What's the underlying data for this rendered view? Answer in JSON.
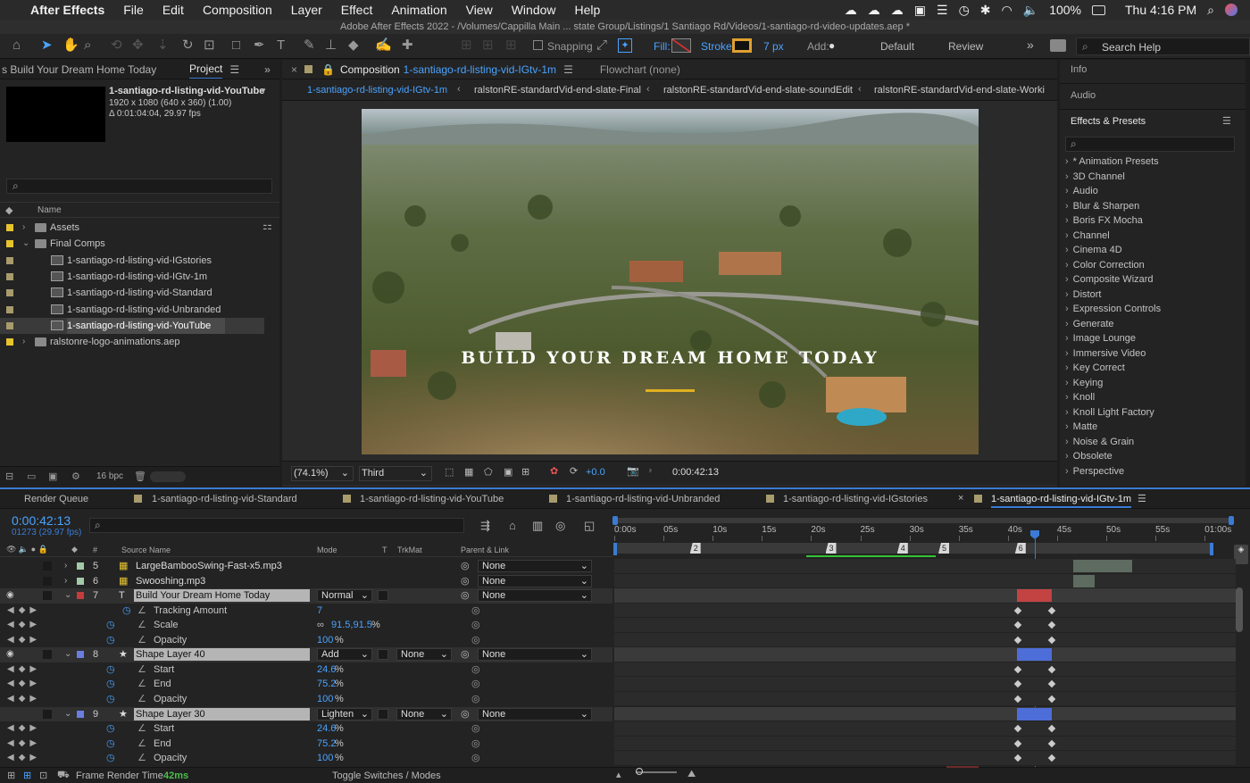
{
  "menubar": {
    "app": "After Effects",
    "items": [
      "File",
      "Edit",
      "Composition",
      "Layer",
      "Effect",
      "Animation",
      "View",
      "Window",
      "Help"
    ],
    "battery": "100%",
    "clock": "Thu 4:16 PM"
  },
  "window_title": "Adobe After Effects 2022 - /Volumes/Cappilla Main ... state Group/Listings/1 Santiago Rd/Videos/1-santiago-rd-video-updates.aep *",
  "toolbar": {
    "snapping": "Snapping",
    "fill": "Fill:",
    "stroke": "Stroke:",
    "stroke_px": "7 px",
    "add": "Add:",
    "workspace_default": "Default",
    "workspace_review": "Review",
    "search_help": "Search Help"
  },
  "project": {
    "tab_prev": "s Build Your Dream Home Today",
    "tab": "Project",
    "selected_name": "1-santiago-rd-listing-vid-YouTube",
    "selected_info1": "1920 x 1080 (640 x 360) (1.00)",
    "selected_info2": "Δ 0:01:04:04, 29.97 fps",
    "col_name": "Name",
    "bpc": "16 bpc",
    "items": [
      {
        "name": "Assets",
        "indent": 0,
        "type": "folder",
        "label": "#e6c42e",
        "open": false
      },
      {
        "name": "Final Comps",
        "indent": 0,
        "type": "folder",
        "label": "#e6c42e",
        "open": true
      },
      {
        "name": "1-santiago-rd-listing-vid-IGstories",
        "indent": 1,
        "type": "comp",
        "label": "#a89b6c"
      },
      {
        "name": "1-santiago-rd-listing-vid-IGtv-1m",
        "indent": 1,
        "type": "comp",
        "label": "#a89b6c"
      },
      {
        "name": "1-santiago-rd-listing-vid-Standard",
        "indent": 1,
        "type": "comp",
        "label": "#a89b6c"
      },
      {
        "name": "1-santiago-rd-listing-vid-Unbranded",
        "indent": 1,
        "type": "comp",
        "label": "#a89b6c"
      },
      {
        "name": "1-santiago-rd-listing-vid-YouTube",
        "indent": 1,
        "type": "comp",
        "label": "#a89b6c",
        "selected": true
      },
      {
        "name": "ralstonre-logo-animations.aep",
        "indent": 0,
        "type": "folder",
        "label": "#e6c42e",
        "open": false
      }
    ]
  },
  "composition": {
    "tab_label": "Composition",
    "tab_name": "1-santiago-rd-listing-vid-IGtv-1m",
    "flowchart": "Flowchart (none)",
    "breadcrumbs": [
      "1-santiago-rd-listing-vid-IGtv-1m",
      "ralstonRE-standardVid-end-slate-Final",
      "ralstonRE-standardVid-end-slate-soundEdit",
      "ralstonRE-standardVid-end-slate-Worki"
    ],
    "overlay_title": "BUILD YOUR DREAM HOME TODAY",
    "zoom": "(74.1%)",
    "resolution": "Third",
    "exposure": "+0.0",
    "timecode": "0:00:42:13"
  },
  "right_panel": {
    "info": "Info",
    "audio": "Audio",
    "effects": "Effects & Presets",
    "effect_items": [
      "* Animation Presets",
      "3D Channel",
      "Audio",
      "Blur & Sharpen",
      "Boris FX Mocha",
      "Channel",
      "Cinema 4D",
      "Color Correction",
      "Composite Wizard",
      "Distort",
      "Expression Controls",
      "Generate",
      "Image Lounge",
      "Immersive Video",
      "Key Correct",
      "Keying",
      "Knoll",
      "Knoll Light Factory",
      "Matte",
      "Noise & Grain",
      "Obsolete",
      "Perspective"
    ]
  },
  "timeline": {
    "tabs": [
      "Render Queue",
      "1-santiago-rd-listing-vid-Standard",
      "1-santiago-rd-listing-vid-YouTube",
      "1-santiago-rd-listing-vid-Unbranded",
      "1-santiago-rd-listing-vid-IGstories",
      "1-santiago-rd-listing-vid-IGtv-1m"
    ],
    "timecode": "0:00:42:13",
    "frame_info": "01273 (29.97 fps)",
    "cols": {
      "num": "#",
      "source": "Source Name",
      "mode": "Mode",
      "t": "T",
      "trkmat": "TrkMat",
      "parent": "Parent & Link"
    },
    "ruler": [
      "0:00s",
      "05s",
      "10s",
      "15s",
      "20s",
      "25s",
      "30s",
      "35s",
      "40s",
      "45s",
      "50s",
      "55s",
      "01:00s"
    ],
    "markers": [
      "2",
      "3",
      "4",
      "5",
      "6"
    ],
    "rows": [
      {
        "kind": "layer",
        "num": "5",
        "name": "LargeBambooSwing-Fast-x5.mp3",
        "label": "#a3c9a8",
        "icon": "audio",
        "parent": "None"
      },
      {
        "kind": "layer",
        "num": "6",
        "name": "Swooshing.mp3",
        "label": "#a3c9a8",
        "icon": "audio",
        "parent": "None"
      },
      {
        "kind": "layer",
        "num": "7",
        "name": "Build Your Dream Home Today",
        "label": "#c43c3c",
        "icon": "text",
        "mode": "Normal",
        "parent": "None",
        "open": true,
        "eye": true
      },
      {
        "kind": "prop",
        "name": "Tracking Amount",
        "value": "7",
        "stopwatch": false
      },
      {
        "kind": "prop",
        "name": "Scale",
        "value": "91.5,91.5",
        "suffix": "%",
        "stopwatch": true,
        "link": true
      },
      {
        "kind": "prop",
        "name": "Opacity",
        "value": "100",
        "suffix": "%",
        "stopwatch": true
      },
      {
        "kind": "layer",
        "num": "8",
        "name": "Shape Layer 40",
        "label": "#6a7ee0",
        "icon": "shape",
        "mode": "Add",
        "trkmat": "None",
        "parent": "None",
        "open": true,
        "eye": true
      },
      {
        "kind": "prop",
        "name": "Start",
        "value": "24.6",
        "suffix": "%",
        "stopwatch": true
      },
      {
        "kind": "prop",
        "name": "End",
        "value": "75.2",
        "suffix": "%",
        "stopwatch": true
      },
      {
        "kind": "prop",
        "name": "Opacity",
        "value": "100",
        "suffix": "%",
        "stopwatch": true
      },
      {
        "kind": "layer",
        "num": "9",
        "name": "Shape Layer 30",
        "label": "#6a7ee0",
        "icon": "shape",
        "mode": "Lighten",
        "trkmat": "None",
        "parent": "None",
        "open": true,
        "eye": false
      },
      {
        "kind": "prop",
        "name": "Start",
        "value": "24.6",
        "suffix": "%",
        "stopwatch": true
      },
      {
        "kind": "prop",
        "name": "End",
        "value": "75.2",
        "suffix": "%",
        "stopwatch": true
      },
      {
        "kind": "prop",
        "name": "Opacity",
        "value": "100",
        "suffix": "%",
        "stopwatch": true
      }
    ],
    "footer_render": "Frame Render Time",
    "footer_ms": "42ms",
    "footer_toggle": "Toggle Switches / Modes"
  }
}
